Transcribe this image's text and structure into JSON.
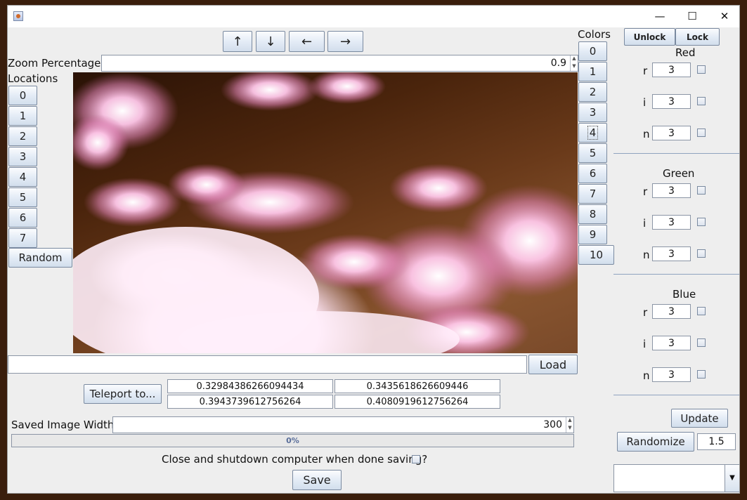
{
  "window": {
    "minimize_glyph": "—",
    "maximize_glyph": "☐",
    "close_glyph": "✕"
  },
  "arrows": {
    "up": "↑",
    "down": "↓",
    "left": "←",
    "right": "→"
  },
  "zoom": {
    "label": "Zoom Percentage:",
    "value": "0.9"
  },
  "locations": {
    "label": "Locations",
    "items": [
      "0",
      "1",
      "2",
      "3",
      "4",
      "5",
      "6",
      "7"
    ],
    "random_label": "Random"
  },
  "colors": {
    "label": "Colors",
    "items": [
      "0",
      "1",
      "2",
      "3",
      "4",
      "5",
      "6",
      "7",
      "8",
      "9",
      "10"
    ],
    "focused": "4"
  },
  "load": {
    "input_value": "",
    "button_label": "Load"
  },
  "teleport": {
    "button_label": "Teleport to...",
    "coords": [
      "0.32984386266094434",
      "0.3435618626609446",
      "0.3943739612756264",
      "0.4080919612756264"
    ]
  },
  "saved_width": {
    "label": "Saved Image Width:",
    "value": "300"
  },
  "progress": {
    "text": "0%",
    "fraction": 0
  },
  "shutdown": {
    "label": "Close and shutdown computer when done saving?"
  },
  "save": {
    "label": "Save"
  },
  "right_panel": {
    "unlock_label": "Unlock",
    "lock_label": "Lock",
    "groups": [
      {
        "title": "Red",
        "fields": [
          {
            "label": "r",
            "value": "3"
          },
          {
            "label": "i",
            "value": "3"
          },
          {
            "label": "n",
            "value": "3"
          }
        ]
      },
      {
        "title": "Green",
        "fields": [
          {
            "label": "r",
            "value": "3"
          },
          {
            "label": "i",
            "value": "3"
          },
          {
            "label": "n",
            "value": "3"
          }
        ]
      },
      {
        "title": "Blue",
        "fields": [
          {
            "label": "r",
            "value": "3"
          },
          {
            "label": "i",
            "value": "3"
          },
          {
            "label": "n",
            "value": "3"
          }
        ]
      }
    ],
    "update_label": "Update",
    "randomize_label": "Randomize",
    "randomize_value": "1.5",
    "dropdown_value": ""
  }
}
